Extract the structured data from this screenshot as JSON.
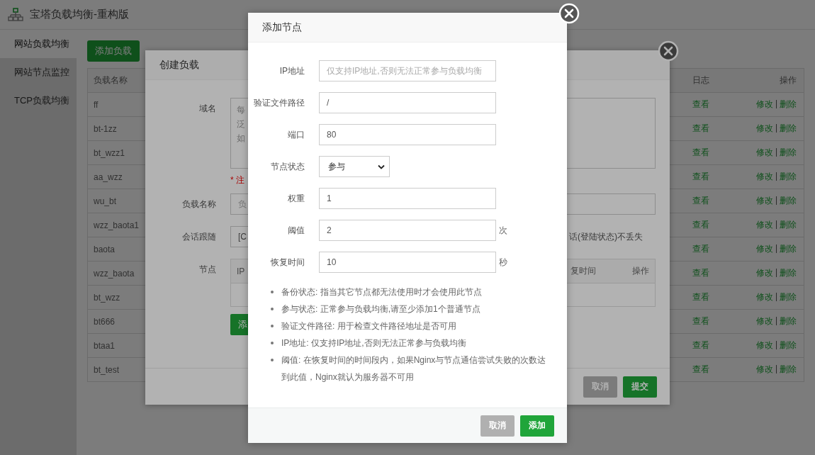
{
  "app": {
    "title": "宝塔负载均衡-重构版"
  },
  "sidebar": {
    "items": [
      {
        "label": "网站负载均衡",
        "selected": true
      },
      {
        "label": "网站节点监控",
        "selected": false
      },
      {
        "label": "TCP负载均衡",
        "selected": false
      }
    ]
  },
  "toolbar": {
    "add_button": "添加负载"
  },
  "table": {
    "columns": [
      {
        "label": "负载名称"
      },
      {
        "label": "日志"
      },
      {
        "label": "操作"
      }
    ],
    "rows": [
      {
        "name": "ff",
        "log": "查看",
        "edit": "修改",
        "separator": "|",
        "delete": "删除"
      },
      {
        "name": "bt-1zz",
        "log": "查看",
        "edit": "修改",
        "separator": "|",
        "delete": "删除"
      },
      {
        "name": "bt_wzz1",
        "log": "查看",
        "edit": "修改",
        "separator": "|",
        "delete": "删除"
      },
      {
        "name": "aa_wzz",
        "log": "查看",
        "edit": "修改",
        "separator": "|",
        "delete": "删除"
      },
      {
        "name": "wu_bt",
        "log": "查看",
        "edit": "修改",
        "separator": "|",
        "delete": "删除"
      },
      {
        "name": "wzz_baota1",
        "log": "查看",
        "edit": "修改",
        "separator": "|",
        "delete": "删除"
      },
      {
        "name": "baota",
        "log": "查看",
        "edit": "修改",
        "separator": "|",
        "delete": "删除"
      },
      {
        "name": "wzz_baota",
        "log": "查看",
        "edit": "修改",
        "separator": "|",
        "delete": "删除"
      },
      {
        "name": "bt_wzz",
        "log": "查看",
        "edit": "修改",
        "separator": "|",
        "delete": "删除"
      },
      {
        "name": "bt666",
        "log": "查看",
        "edit": "修改",
        "separator": "|",
        "delete": "删除"
      },
      {
        "name": "btaa1",
        "log": "查看",
        "edit": "修改",
        "separator": "|",
        "delete": "删除"
      },
      {
        "name": "bt_test",
        "log": "查看",
        "edit": "修改",
        "separator": "|",
        "delete": "删除"
      }
    ]
  },
  "create_dialog": {
    "title": "创建负载",
    "domain_label": "域名",
    "domain_lines": [
      "每",
      "泛",
      "如"
    ],
    "note": "* 注",
    "name_label": "负载名称",
    "name_placeholder": "负",
    "session_label": "会话跟随",
    "session_value": "[C",
    "session_hint": "话(登陆状态)不丢失",
    "nodes_label": "节点",
    "nodes_columns_left": [
      "IP"
    ],
    "nodes_columns_right": [
      "复时间",
      "操作"
    ],
    "add_node_button": "添",
    "buttons": [
      {
        "label": "取消",
        "kind": "cancel"
      },
      {
        "label": "提交",
        "kind": "primary"
      }
    ]
  },
  "node_dialog": {
    "title": "添加节点",
    "fields": [
      {
        "label": "IP地址",
        "kind": "text",
        "placeholder": "仅支持IP地址,否则无法正常参与负载均衡"
      },
      {
        "label": "验证文件路径",
        "kind": "text",
        "value": "/"
      },
      {
        "label": "端口",
        "kind": "text",
        "value": "80"
      },
      {
        "label": "节点状态",
        "kind": "select",
        "value": "参与"
      },
      {
        "label": "权重",
        "kind": "text",
        "value": "1"
      },
      {
        "label": "阈值",
        "kind": "text",
        "value": "2",
        "unit": "次"
      },
      {
        "label": "恢复时间",
        "kind": "text",
        "value": "10",
        "unit": "秒"
      }
    ],
    "notes": [
      "备份状态: 指当其它节点都无法使用时才会使用此节点",
      "参与状态: 正常参与负载均衡,请至少添加1个普通节点",
      "验证文件路径: 用于检查文件路径地址是否可用",
      "IP地址: 仅支持IP地址,否则无法正常参与负载均衡",
      "阈值: 在恢复时间的时间段内，如果Nginx与节点通信尝试失败的次数达到此值，Nginx就认为服务器不可用"
    ],
    "buttons": [
      {
        "label": "取消",
        "kind": "cancel"
      },
      {
        "label": "添加",
        "kind": "primary"
      }
    ]
  }
}
